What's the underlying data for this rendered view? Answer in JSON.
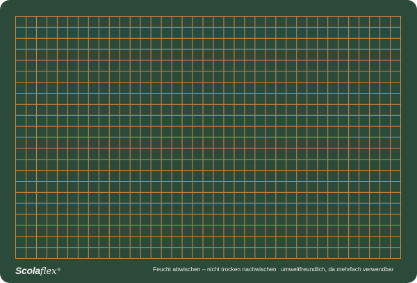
{
  "board": {
    "brand_main": "Scola",
    "brand_tail": "flex",
    "brand_mark": "®",
    "note_left": "Feucht abwischen – nicht trocken nachwischen",
    "note_right": "umweltfreundlich, da mehrfach verwendbar"
  },
  "grid": {
    "columns": 37,
    "rows": 22,
    "line_color": "#c8894a",
    "background_color": "#2c4a3a"
  }
}
